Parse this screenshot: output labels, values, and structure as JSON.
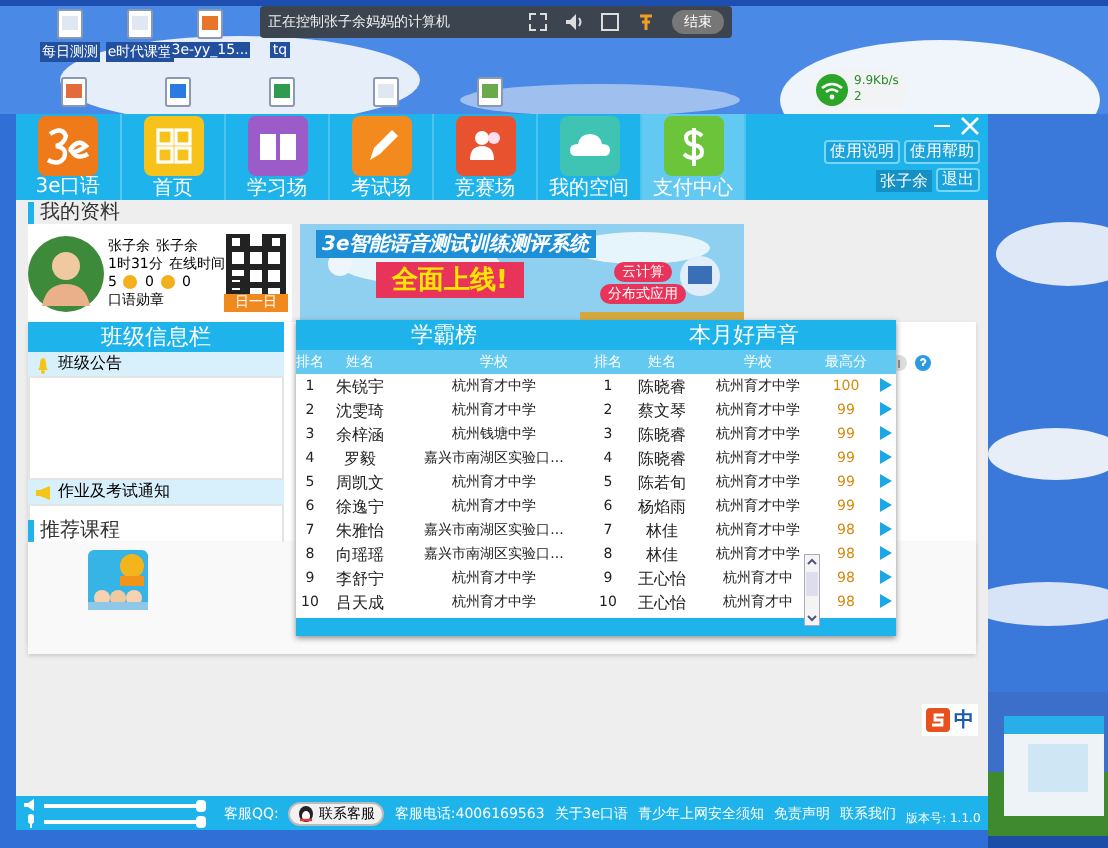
{
  "desktop": {
    "icons": [
      {
        "kind": "doc",
        "label": "每日测测"
      },
      {
        "kind": "doc",
        "label": "e时代课堂"
      },
      {
        "kind": "app",
        "label": "3e-yy_15..."
      },
      {
        "kind": "blank",
        "label": "tq"
      }
    ],
    "icons_row2": [
      {
        "kind": "ppt"
      },
      {
        "kind": "browser"
      },
      {
        "kind": "sheet"
      },
      {
        "kind": "doc"
      },
      {
        "kind": "installer"
      }
    ],
    "remote_bar": {
      "text": "正在控制张子余妈妈的计算机",
      "button": "结束"
    },
    "network": {
      "upload": "9.9Kb/s",
      "download": "2"
    },
    "ime": {
      "label": "中"
    }
  },
  "app": {
    "logo": "3e口语",
    "nav": [
      {
        "label": "首页",
        "selected": false
      },
      {
        "label": "学习场",
        "selected": false
      },
      {
        "label": "考试场",
        "selected": false
      },
      {
        "label": "竞赛场",
        "selected": false
      },
      {
        "label": "我的空间",
        "selected": false
      },
      {
        "label": "支付中心",
        "selected": true
      }
    ],
    "top_links": [
      "使用说明",
      "使用帮助"
    ],
    "user": "张子余",
    "logout": "退出",
    "profile": {
      "title": "我的资料",
      "names": [
        "张子余",
        "张子余"
      ],
      "online_time": "1时31分",
      "online_label": "在线时间",
      "counts": [
        "5",
        "0",
        "0"
      ],
      "medal_label": "口语勋章",
      "qr_button": "日一日"
    },
    "banner": {
      "title": "3e智能语音测试训练测评系统",
      "headline": "全面上线!",
      "tags": [
        "云计算",
        "分布式应用"
      ]
    },
    "class_panel": {
      "title": "班级信息栏",
      "sections": [
        "班级公告",
        "作业及考试通知"
      ]
    },
    "courses": {
      "title": "推荐课程"
    },
    "leaderboards": [
      {
        "title": "学霸榜",
        "columns": [
          "排名",
          "姓名",
          "学校"
        ],
        "rows": [
          [
            "1",
            "朱锐宇",
            "杭州育才中学"
          ],
          [
            "2",
            "沈雯琦",
            "杭州育才中学"
          ],
          [
            "3",
            "余梓涵",
            "杭州钱塘中学"
          ],
          [
            "4",
            "罗毅",
            "嘉兴市南湖区实验口..."
          ],
          [
            "5",
            "周凯文",
            "杭州育才中学"
          ],
          [
            "6",
            "徐逸宁",
            "杭州育才中学"
          ],
          [
            "7",
            "朱雅怡",
            "嘉兴市南湖区实验口..."
          ],
          [
            "8",
            "向瑶瑶",
            "嘉兴市南湖区实验口..."
          ],
          [
            "9",
            "李舒宁",
            "杭州育才中学"
          ],
          [
            "10",
            "吕天成",
            "杭州育才中学"
          ]
        ]
      },
      {
        "title": "本月好声音",
        "columns": [
          "排名",
          "姓名",
          "学校",
          "最高分"
        ],
        "rows": [
          [
            "1",
            "陈晓睿",
            "杭州育才中学",
            "100"
          ],
          [
            "2",
            "蔡文琴",
            "杭州育才中学",
            "99"
          ],
          [
            "3",
            "陈晓睿",
            "杭州育才中学",
            "99"
          ],
          [
            "4",
            "陈晓睿",
            "杭州育才中学",
            "99"
          ],
          [
            "5",
            "陈若旬",
            "杭州育才中学",
            "99"
          ],
          [
            "6",
            "杨焰雨",
            "杭州育才中学",
            "99"
          ],
          [
            "7",
            "林佳",
            "杭州育才中学",
            "98"
          ],
          [
            "8",
            "林佳",
            "杭州育才中学",
            "98"
          ],
          [
            "9",
            "王心怡",
            "杭州育才中",
            "98"
          ],
          [
            "10",
            "王心怡",
            "杭州育才中",
            "98"
          ]
        ]
      }
    ],
    "footer": {
      "sliders": [
        {
          "level": 0.97
        },
        {
          "level": 0.97
        }
      ],
      "qq_label": "客服QQ:",
      "qq_button": "联系客服",
      "phone": "客服电话:4006169563",
      "links": [
        "关于3e口语",
        "青少年上网安全须知",
        "免责声明",
        "联系我们"
      ],
      "version": "版本号: 1.1.0"
    }
  }
}
